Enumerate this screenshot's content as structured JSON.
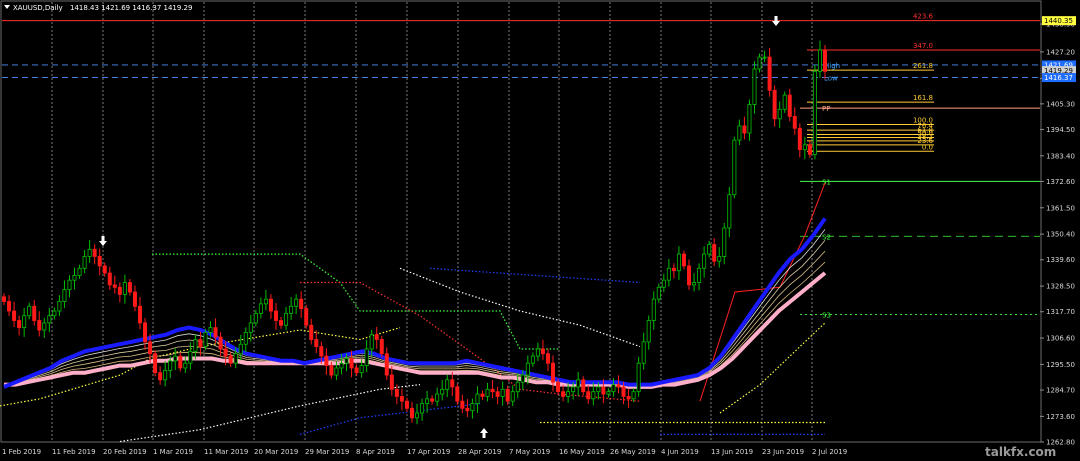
{
  "header": {
    "symbol": "XAUUSD,Daily",
    "ohlc": "1418.43 1421.69 1416.37 1419.29"
  },
  "watermark": "talkfx.com",
  "colors": {
    "bull": "#00c000",
    "bear": "#ff1a1a",
    "ema_blue": "#1a1aff",
    "ema_pink": "#ffb0c8",
    "fib": "#ffcc33",
    "pivot": "#ffa080",
    "support": "#40ff40"
  },
  "chart_data": {
    "type": "candlestick",
    "ylim": [
      1262.8,
      1444.0
    ],
    "y_ticks": [
      "1438.90",
      "1427.20",
      "1416.00",
      "1405.30",
      "1394.50",
      "1383.40",
      "1372.60",
      "1361.50",
      "1350.40",
      "1339.60",
      "1328.50",
      "1317.70",
      "1306.60",
      "1295.50",
      "1284.70",
      "1273.60",
      "1262.80"
    ],
    "x_ticks": [
      "1 Feb 2019",
      "11 Feb 2019",
      "20 Feb 2019",
      "1 Mar 2019",
      "11 Mar 2019",
      "20 Mar 2019",
      "29 Mar 2019",
      "8 Apr 2019",
      "17 Apr 2019",
      "28 Apr 2019",
      "7 May 2019",
      "16 May 2019",
      "26 May 2019",
      "4 Jun 2019",
      "13 Jun 2019",
      "23 Jun 2019",
      "2 Jul 2019"
    ],
    "close_path": [
      1322,
      1318,
      1314,
      1311,
      1316,
      1320,
      1314,
      1310,
      1313,
      1316,
      1318,
      1322,
      1327,
      1331,
      1333,
      1336,
      1341,
      1344,
      1341,
      1337,
      1334,
      1329,
      1328,
      1325,
      1330,
      1326,
      1320,
      1313,
      1305,
      1300,
      1292,
      1289,
      1293,
      1297,
      1299,
      1294,
      1296,
      1301,
      1306,
      1303,
      1309,
      1311,
      1307,
      1302,
      1299,
      1296,
      1300,
      1304,
      1309,
      1313,
      1317,
      1321,
      1323,
      1318,
      1314,
      1312,
      1317,
      1320,
      1323,
      1319,
      1312,
      1306,
      1303,
      1299,
      1295,
      1291,
      1294,
      1296,
      1298,
      1294,
      1292,
      1295,
      1302,
      1308,
      1306,
      1300,
      1291,
      1285,
      1282,
      1280,
      1277,
      1273,
      1275,
      1279,
      1281,
      1280,
      1283,
      1285,
      1289,
      1286,
      1280,
      1277,
      1276,
      1279,
      1283,
      1282,
      1285,
      1284,
      1282,
      1285,
      1280,
      1284,
      1288,
      1291,
      1296,
      1299,
      1302,
      1300,
      1296,
      1288,
      1284,
      1282,
      1284,
      1286,
      1289,
      1284,
      1281,
      1284,
      1286,
      1283,
      1284,
      1287,
      1286,
      1282,
      1281,
      1284,
      1296,
      1305,
      1314,
      1323,
      1328,
      1331,
      1336,
      1335,
      1342,
      1337,
      1329,
      1330,
      1336,
      1342,
      1346,
      1339,
      1341,
      1353,
      1367,
      1390,
      1396,
      1393,
      1405,
      1420,
      1425,
      1425,
      1411,
      1399,
      1403,
      1409,
      1400,
      1395,
      1386,
      1388,
      1384,
      1419,
      1428,
      1419
    ],
    "series": [
      {
        "name": "",
        "type": "ema",
        "values": [
          1286,
          1288,
          1290,
          1292,
          1294,
          1297,
          1299,
          1301,
          1302,
          1303,
          1304,
          1305,
          1306,
          1307,
          1308,
          1310,
          1311,
          1310,
          1308,
          1305,
          1302,
          1300,
          1299,
          1298,
          1297,
          1297,
          1296,
          1297,
          1298,
          1299,
          1300,
          1301,
          1300,
          1298,
          1297,
          1296,
          1296,
          1296,
          1296,
          1296,
          1297,
          1296,
          1295,
          1294,
          1293,
          1292,
          1291,
          1290,
          1289,
          1288,
          1288,
          1288,
          1288,
          1288,
          1287,
          1287,
          1287,
          1288,
          1289,
          1290,
          1291,
          1294,
          1299,
          1306,
          1313,
          1320,
          1327,
          1334,
          1340,
          1344,
          1350,
          1357
        ]
      },
      {
        "name": "",
        "type": "ema",
        "values": [
          1287,
          1287,
          1288,
          1289,
          1290,
          1291,
          1292,
          1292,
          1293,
          1294,
          1295,
          1295,
          1296,
          1297,
          1297,
          1298,
          1298,
          1298,
          1298,
          1297,
          1297,
          1296,
          1296,
          1296,
          1296,
          1296,
          1296,
          1296,
          1296,
          1296,
          1297,
          1297,
          1296,
          1295,
          1294,
          1293,
          1292,
          1292,
          1292,
          1292,
          1292,
          1292,
          1291,
          1290,
          1290,
          1289,
          1288,
          1288,
          1287,
          1287,
          1287,
          1287,
          1287,
          1287,
          1286,
          1286,
          1286,
          1287,
          1287,
          1288,
          1289,
          1291,
          1294,
          1298,
          1303,
          1308,
          1313,
          1318,
          1322,
          1326,
          1330,
          1334
        ]
      }
    ],
    "levels": [
      {
        "label": "423.6",
        "price": 1440.35,
        "color": "#ff3030"
      },
      {
        "label": "347.0",
        "price": 1428.0,
        "color": "#ff3030"
      },
      {
        "label": "261.8",
        "price": 1419.5,
        "color": "#ffcc33"
      },
      {
        "label": "161.8",
        "price": 1406.0,
        "color": "#ffcc33"
      },
      {
        "label": "100.0",
        "price": 1396.6,
        "color": "#ffcc33"
      },
      {
        "label": "76.4",
        "price": 1394.2,
        "color": "#ffcc33"
      },
      {
        "label": "61.8",
        "price": 1392.4,
        "color": "#ffcc33"
      },
      {
        "label": "50.0",
        "price": 1391.1,
        "color": "#ffcc33"
      },
      {
        "label": "38.2",
        "price": 1389.7,
        "color": "#ffcc33"
      },
      {
        "label": "23.6",
        "price": 1388.0,
        "color": "#ffcc33"
      },
      {
        "label": "0.0",
        "price": 1385.3,
        "color": "#ffcc33"
      }
    ],
    "pivot_labels": [
      {
        "label": "High",
        "price": 1421.69,
        "color": "#40a0ff"
      },
      {
        "label": "Low",
        "price": 1416.37,
        "color": "#40a0ff"
      },
      {
        "label": "PP",
        "price": 1403.5,
        "color": "#ffa080"
      },
      {
        "label": "S1",
        "price": 1372.6,
        "color": "#40ff40"
      },
      {
        "label": "S2",
        "price": 1349.5,
        "color": "#40ff40"
      },
      {
        "label": "S3",
        "price": 1316.5,
        "color": "#40ff40"
      }
    ],
    "price_tags": [
      {
        "label": "1440.35",
        "price": 1440.35,
        "bg": "#ffff40",
        "fg": "#000000"
      },
      {
        "label": "1421.69",
        "price": 1421.69,
        "bg": "#1e6cff",
        "fg": "#ffffff"
      },
      {
        "label": "1419.29",
        "price": 1419.29,
        "bg": "#d0d0d0",
        "fg": "#000000"
      },
      {
        "label": "1416.37",
        "price": 1416.37,
        "bg": "#1e6cff",
        "fg": "#ffffff"
      }
    ]
  }
}
